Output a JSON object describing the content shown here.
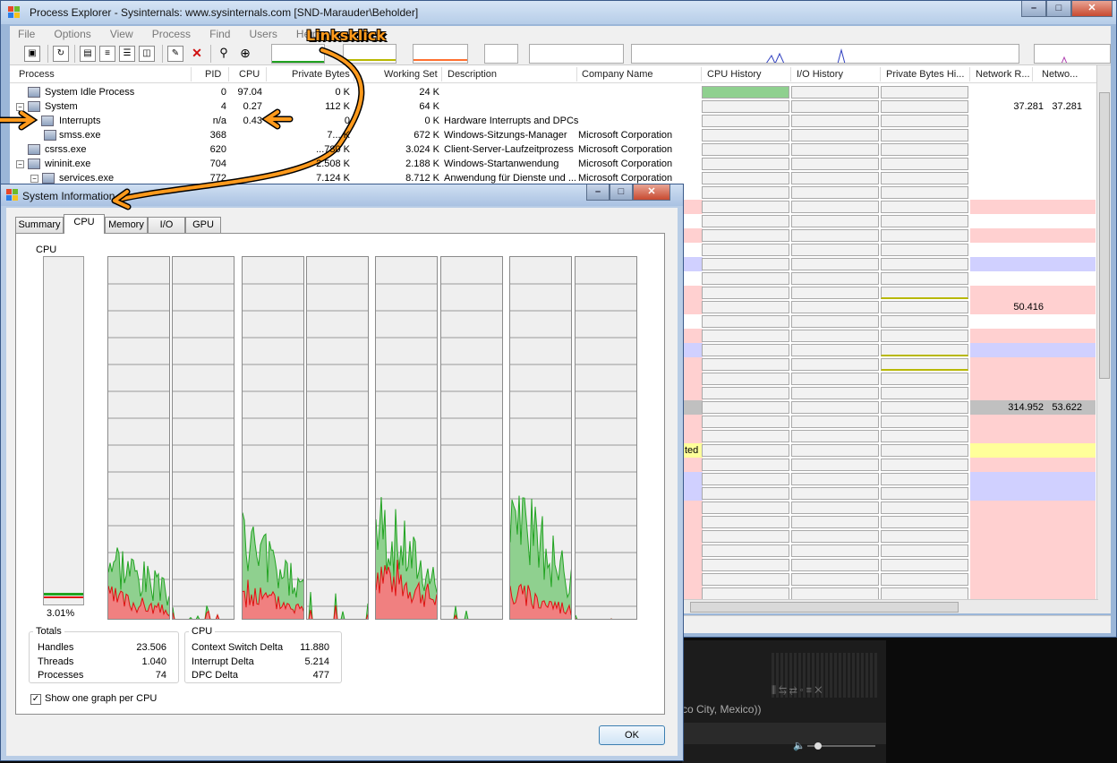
{
  "process_explorer": {
    "title": "Process Explorer - Sysinternals: www.sysinternals.com [SND-Marauder\\Beholder]",
    "menu": [
      "File",
      "Options",
      "View",
      "Process",
      "Find",
      "Users",
      "Help"
    ],
    "columns": [
      "Process",
      "PID",
      "CPU",
      "Private Bytes",
      "Working Set",
      "Description",
      "Company Name",
      "CPU History",
      "I/O History",
      "Private Bytes Hi...",
      "Network R...",
      "Netwo..."
    ],
    "rows": [
      {
        "name": "System Idle Process",
        "pid": "0",
        "cpu": "97.04",
        "private": "0 K",
        "working": "24 K",
        "desc": "",
        "company": "",
        "netr": "",
        "netw": ""
      },
      {
        "name": "System",
        "pid": "4",
        "cpu": "0.27",
        "private": "112 K",
        "working": "64 K",
        "desc": "",
        "company": "",
        "netr": "37.281",
        "netw": "37.281"
      },
      {
        "name": "Interrupts",
        "pid": "n/a",
        "cpu": "0.43",
        "private": "0",
        "working": "0 K",
        "desc": "Hardware Interrupts and DPCs",
        "company": "",
        "netr": "",
        "netw": ""
      },
      {
        "name": "smss.exe",
        "pid": "368",
        "cpu": "",
        "private": "7... K",
        "working": "672 K",
        "desc": "Windows-Sitzungs-Manager",
        "company": "Microsoft Corporation",
        "netr": "",
        "netw": ""
      },
      {
        "name": "csrss.exe",
        "pid": "620",
        "cpu": "",
        "private": "...780 K",
        "working": "3.024 K",
        "desc": "Client-Server-Laufzeitprozess",
        "company": "Microsoft Corporation",
        "netr": "",
        "netw": ""
      },
      {
        "name": "wininit.exe",
        "pid": "704",
        "cpu": "",
        "private": "2.508 K",
        "working": "2.188 K",
        "desc": "Windows-Startanwendung",
        "company": "Microsoft Corporation",
        "netr": "",
        "netw": ""
      },
      {
        "name": "services.exe",
        "pid": "772",
        "cpu": "",
        "private": "7.124 K",
        "working": "8.712 K",
        "desc": "Anwendung für Dienste und ...",
        "company": "Microsoft Corporation",
        "netr": "",
        "netw": ""
      }
    ],
    "net_values": [
      {
        "row": 15,
        "netr": "50.416",
        "netw": ""
      },
      {
        "row": 22,
        "netr": "314.952",
        "netw": "53.622"
      }
    ],
    "row_fragment": "ted"
  },
  "annotation": {
    "label": "Linksklick"
  },
  "sysinfo": {
    "title": "System Information",
    "tabs": [
      "Summary",
      "CPU",
      "Memory",
      "I/O",
      "GPU"
    ],
    "active_tab": "CPU",
    "cpu_label": "CPU",
    "cpu_percent": "3.01%",
    "cpu_usage_fraction": 0.0301,
    "totals": {
      "legend": "Totals",
      "items": [
        {
          "label": "Handles",
          "value": "23.506"
        },
        {
          "label": "Threads",
          "value": "1.040"
        },
        {
          "label": "Processes",
          "value": "74"
        }
      ]
    },
    "cpu_stats": {
      "legend": "CPU",
      "items": [
        {
          "label": "Context Switch Delta",
          "value": "11.880"
        },
        {
          "label": "Interrupt Delta",
          "value": "5.214"
        },
        {
          "label": "DPC Delta",
          "value": "477"
        }
      ]
    },
    "checkbox_label": "Show one graph per CPU",
    "checkbox_checked": true,
    "ok_label": "OK"
  },
  "media_player": {
    "location_text": "co City, Mexico))"
  },
  "colors": {
    "cpu_green": "#21a321",
    "cpu_red": "#e01010",
    "cpu_fill_red": "#f08080",
    "cpu_fill_green": "#8fd08f",
    "highlight_pink": "#ffd0d0",
    "highlight_blue": "#d0d0ff",
    "highlight_yellow": "#ffff9a",
    "highlight_gray": "#c0c0c0",
    "annotation_orange": "#ff9a1c"
  }
}
